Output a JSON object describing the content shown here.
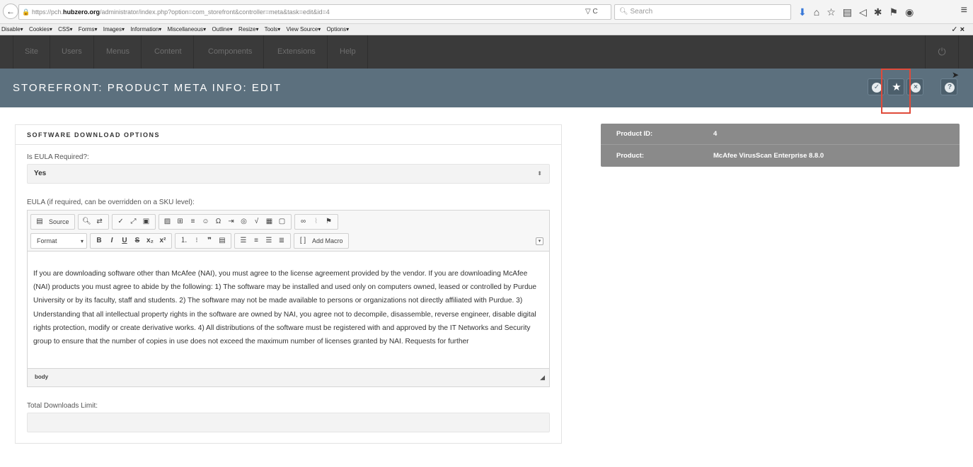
{
  "browser": {
    "url_prefix": "https://pch.",
    "url_host": "hubzero.org",
    "url_path": "/administrator/index.php?option=com_storefront&controller=meta&task=edit&id=4",
    "url_tools": "▽ C",
    "search_placeholder": "Search"
  },
  "devtoolbar": {
    "items": [
      "Disable▾",
      "Cookies▾",
      "CSS▾",
      "Forms▾",
      "Images▾",
      "Information▾",
      "Miscellaneous▾",
      "Outline▾",
      "Resize▾",
      "Tools▾",
      "View Source▾",
      "Options▾"
    ],
    "close": "✓ ×"
  },
  "admin_nav": {
    "items": [
      "Site",
      "Users",
      "Menus",
      "Content",
      "Components",
      "Extensions",
      "Help"
    ]
  },
  "toolbar_title": "STOREFRONT: PRODUCT META INFO: EDIT",
  "panel": {
    "heading": "SOFTWARE DOWNLOAD OPTIONS",
    "eula_required_label": "Is EULA Required?:",
    "eula_required_value": "Yes",
    "eula_label": "EULA (if required, can be overridden on a SKU level):",
    "editor": {
      "source_label": "Source",
      "format_label": "Format",
      "add_macro_label": "Add Macro",
      "status_path": "body",
      "content": "If you are downloading software other than McAfee (NAI), you must agree to the license agreement provided by the vendor.  If you are downloading McAfee (NAI) products you must agree to abide by the following: 1) The software may be installed and used only on computers owned, leased or controlled by Purdue University or by its faculty, staff and students. 2) The software may not be made available to persons or organizations not directly affiliated with Purdue. 3) Understanding that all intellectual property rights in the software are owned by NAI, you agree not to decompile, disassemble, reverse engineer, disable digital rights protection, modify or create derivative works. 4) All distributions of the software must be registered with and approved by the IT Networks and Security group to ensure that the number of copies in use does not exceed the maximum number of licenses granted by NAI. Requests for further"
    },
    "downloads_limit_label": "Total Downloads Limit:",
    "downloads_limit_value": ""
  },
  "info": {
    "product_id_label": "Product ID:",
    "product_id_value": "4",
    "product_label": "Product:",
    "product_value": "McAfee VirusScan Enterprise 8.8.0"
  },
  "colors": {
    "title_bar": "#5c707e",
    "nav_bar": "#3a3a3a",
    "info_panel": "#8a8a8a",
    "highlight": "#e04a3a"
  }
}
